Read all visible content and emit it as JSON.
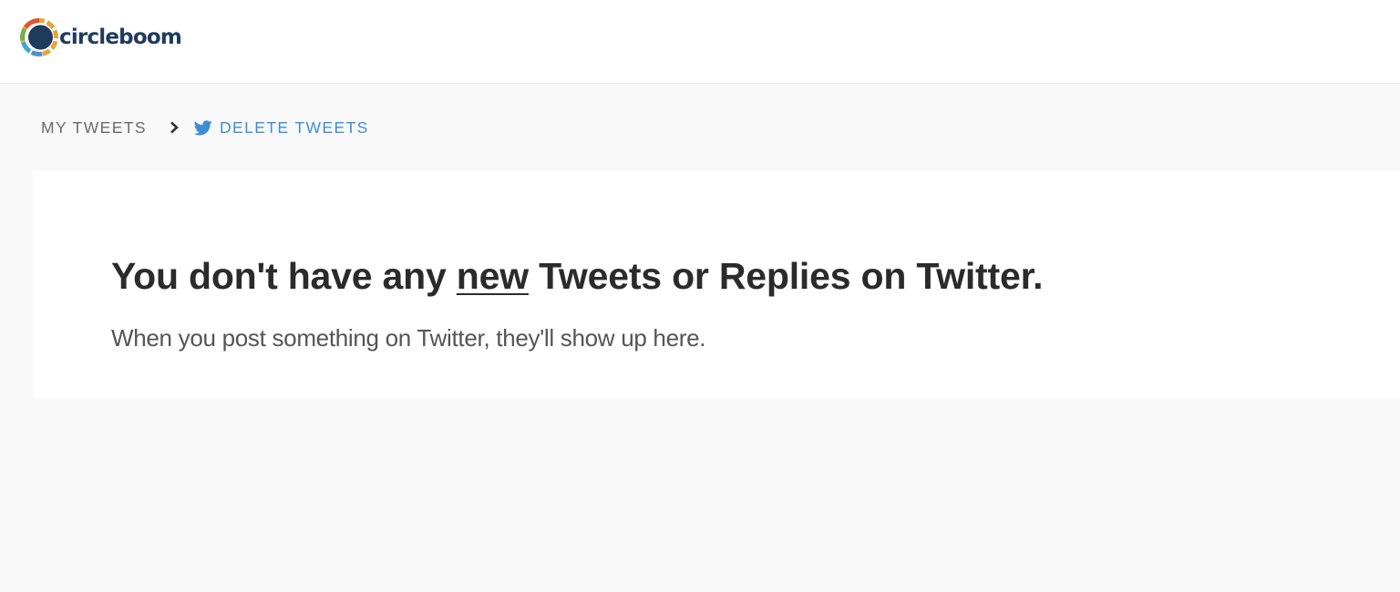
{
  "header": {
    "brand_name": "circleboom",
    "logo_icon": "circleboom-logo-icon"
  },
  "breadcrumb": {
    "first_label": "MY TWEETS",
    "separator_icon": "chevron-right-icon",
    "current_icon": "twitter-bird-icon",
    "current_label": "DELETE TWEETS"
  },
  "empty_state": {
    "heading_before": "You don't have any ",
    "heading_emphasis": "new",
    "heading_after": " Tweets or Replies on Twitter.",
    "message": "When you post something on Twitter, they'll show up here."
  },
  "colors": {
    "brand_navy": "#1f3b5c",
    "link_blue": "#3d8ed6",
    "page_background": "#f9f9f9"
  }
}
